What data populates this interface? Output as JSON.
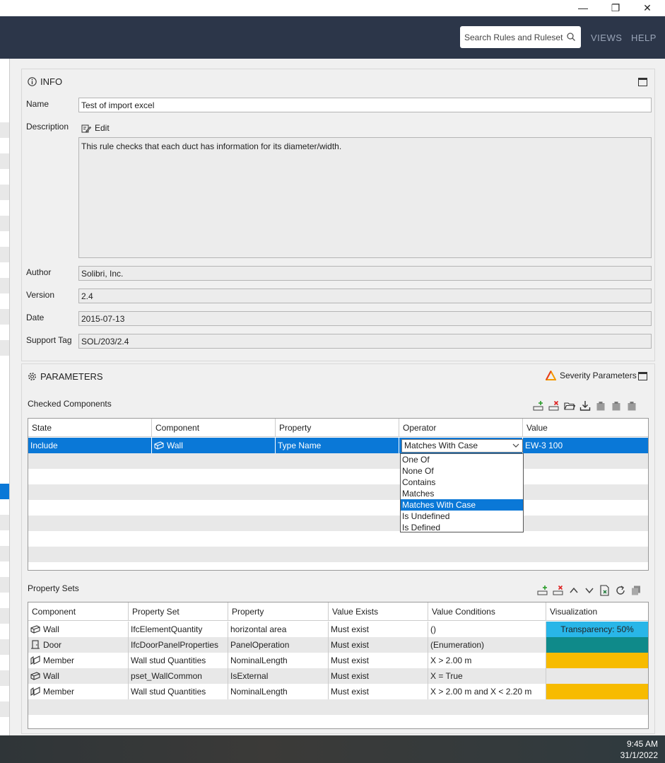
{
  "window": {
    "minimize": "—",
    "restore": "❐",
    "close": "✕"
  },
  "header": {
    "search_placeholder": "Search Rules and Rulesets",
    "views": "VIEWS",
    "help": "HELP"
  },
  "info": {
    "title": "INFO",
    "name_label": "Name",
    "name_value": "Test of import excel",
    "description_label": "Description",
    "edit_label": "Edit",
    "description_value": "This rule checks that each duct has information for its diameter/width.",
    "author_label": "Author",
    "author_value": "Solibri, Inc.",
    "version_label": "Version",
    "version_value": "2.4",
    "date_label": "Date",
    "date_value": "2015-07-13",
    "support_label": "Support Tag",
    "support_value": "SOL/203/2.4"
  },
  "parameters": {
    "title": "PARAMETERS",
    "severity_label": "Severity Parameters",
    "checked_label": "Checked Components",
    "checked_headers": [
      "State",
      "Component",
      "Property",
      "Operator",
      "Value"
    ],
    "checked_row": {
      "state": "Include",
      "component": "Wall",
      "property": "Type Name",
      "operator": "Matches With Case",
      "value": "EW-3 100"
    },
    "operator_options": [
      "One Of",
      "None Of",
      "Contains",
      "Matches",
      "Matches With Case",
      "Is Undefined",
      "Is Defined"
    ],
    "property_sets_label": "Property Sets",
    "ps_headers": [
      "Component",
      "Property Set",
      "Property",
      "Value Exists",
      "Value Conditions",
      "Visualization"
    ],
    "ps_rows": [
      {
        "component": "Wall",
        "icon": "wall-icon",
        "pset": "IfcElementQuantity",
        "property": "horizontal area",
        "exists": "Must exist",
        "conditions": "()",
        "vis": "Transparency: 50%",
        "vis_color": "#29b6e8"
      },
      {
        "component": "Door",
        "icon": "door-icon",
        "pset": "IfcDoorPanelProperties",
        "property": "PanelOperation",
        "exists": "Must exist",
        "conditions": "(Enumeration)",
        "vis": "",
        "vis_color": "#0f8a8a"
      },
      {
        "component": "Member",
        "icon": "member-icon",
        "pset": "Wall stud Quantities",
        "property": "NominalLength",
        "exists": "Must exist",
        "conditions": "X > 2.00 m",
        "vis": "",
        "vis_color": "#f7bb00"
      },
      {
        "component": "Wall",
        "icon": "wall-icon",
        "pset": "pset_WallCommon",
        "property": "IsExternal",
        "exists": "Must exist",
        "conditions": "X = True",
        "vis": "",
        "vis_color": "#e8e8e8"
      },
      {
        "component": "Member",
        "icon": "member-icon",
        "pset": "Wall stud Quantities",
        "property": "NominalLength",
        "exists": "Must exist",
        "conditions": "X > 2.00 m and X < 2.20 m",
        "vis": "",
        "vis_color": "#f7bb00"
      }
    ]
  },
  "taskbar": {
    "time": "9:45 AM",
    "date": "31/1/2022"
  }
}
